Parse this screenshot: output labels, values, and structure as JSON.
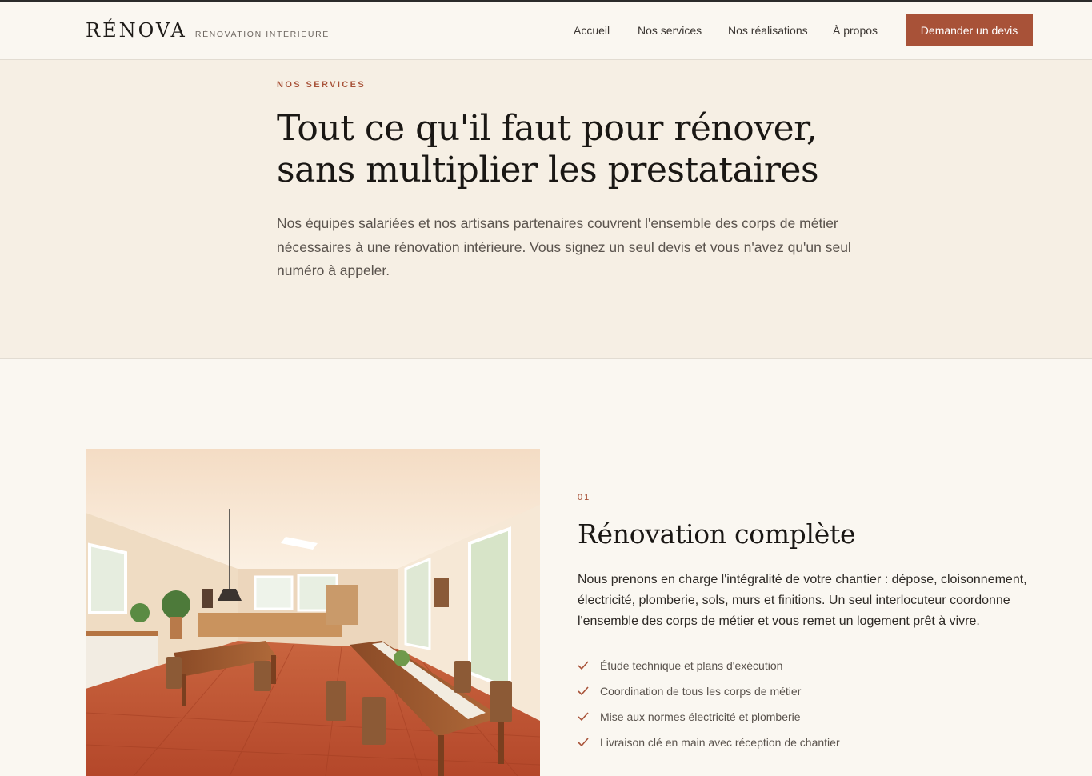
{
  "header": {
    "logo": "RÉNOVA",
    "tagline": "RÉNOVATION INTÉRIEURE",
    "nav": [
      "Accueil",
      "Nos services",
      "Nos réalisations",
      "À propos"
    ],
    "cta": "Demander un devis"
  },
  "hero": {
    "eyebrow": "NOS SERVICES",
    "title_line1": "Tout ce qu'il faut pour rénover,",
    "title_line2": "sans multiplier les prestataires",
    "intro": "Nos équipes salariées et nos artisans partenaires couvrent l'ensemble des corps de métier nécessaires à une rénovation intérieure. Vous signez un seul devis et vous n'avez qu'un seul numéro à appeler."
  },
  "service": {
    "number": "01",
    "title": "Rénovation complète",
    "description": "Nous prenons en charge l'intégralité de votre chantier : dépose, cloisonnement, électricité, plomberie, sols, murs et finitions. Un seul interlocuteur coordonne l'ensemble des corps de métier et vous remet un logement prêt à vivre.",
    "features": [
      "Étude technique et plans d'exécution",
      "Coordination de tous les corps de métier",
      "Mise aux normes électricité et plomberie",
      "Livraison clé en main avec réception de chantier"
    ]
  },
  "colors": {
    "accent": "#a85238",
    "page_bg": "#faf7f1",
    "hero_bg": "#f6efe4"
  }
}
